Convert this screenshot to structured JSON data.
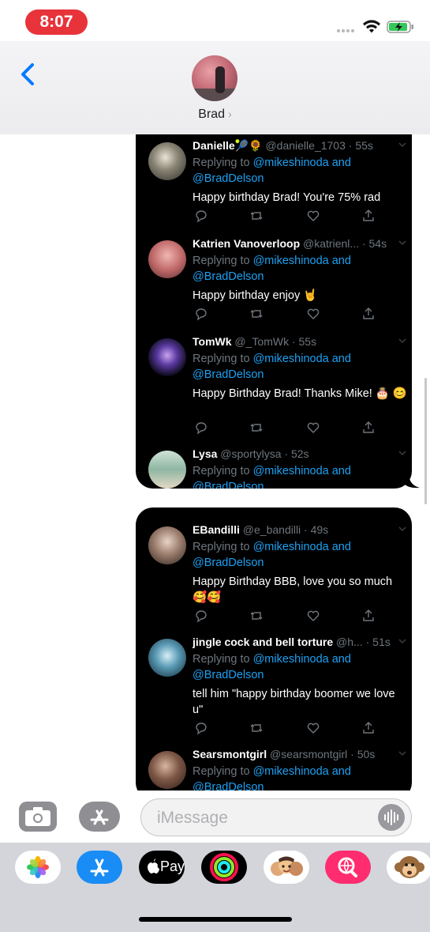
{
  "status_bar": {
    "time": "8:07"
  },
  "header": {
    "contact_name": "Brad"
  },
  "bubble1": {
    "tweets": [
      {
        "name": "Danielle",
        "handle_meta": "@danielle_1703 · 55s",
        "reply_prefix": "Replying to ",
        "mention1": "@mikeshinoda",
        "reply_and": " and",
        "mention2": "@BradDelson",
        "text": "Happy birthday Brad! You're 75% rad"
      },
      {
        "name": "Katrien Vanoverloop",
        "handle_meta": "@katrienl... · 54s",
        "reply_prefix": "Replying to ",
        "mention1": "@mikeshinoda",
        "reply_and": " and",
        "mention2": "@BradDelson",
        "text": "Happy birthday enjoy 🤘"
      },
      {
        "name": "TomWk",
        "handle_meta": "@_TomWk · 55s",
        "reply_prefix": "Replying to ",
        "mention1": "@mikeshinoda",
        "reply_and": " and",
        "mention2": "@BradDelson",
        "text": "Happy Birthday Brad! Thanks Mike! 🎂 😊"
      },
      {
        "name": "Lysa",
        "handle_meta": "@sportylysa · 52s",
        "reply_prefix": "Replying to ",
        "mention1": "@mikeshinoda",
        "reply_and": " and",
        "mention2": "@BradDelson",
        "text": ""
      }
    ]
  },
  "bubble2": {
    "tweets": [
      {
        "name": "EBandilli",
        "handle_meta": "@e_bandilli · 49s",
        "reply_prefix": "Replying to ",
        "mention1": "@mikeshinoda",
        "reply_and": " and",
        "mention2": "@BradDelson",
        "text": "Happy Birthday BBB, love you so much 🥰🥰"
      },
      {
        "name": "jingle cock and bell torture",
        "handle_meta": "@h... · 51s",
        "reply_prefix": "Replying to ",
        "mention1": "@mikeshinoda",
        "reply_and": " and",
        "mention2": "@BradDelson",
        "text": "tell him \"happy birthday boomer we love u\""
      },
      {
        "name": "Searsmontgirl",
        "handle_meta": "@searsmontgirl · 50s",
        "reply_prefix": "Replying to ",
        "mention1": "@mikeshinoda",
        "reply_and": " and",
        "mention2": "@BradDelson",
        "text": ""
      }
    ]
  },
  "input": {
    "placeholder": "iMessage"
  },
  "drawer": {
    "apps": [
      {
        "icon": "photos-app-icon"
      },
      {
        "icon": "app-store-icon"
      },
      {
        "icon": "apple-pay-icon",
        "label": "Pay"
      },
      {
        "icon": "activity-rings-icon"
      },
      {
        "icon": "memoji-icon"
      },
      {
        "icon": "image-search-icon"
      },
      {
        "icon": "animoji-monkey-icon"
      }
    ]
  },
  "colors": {
    "accent": "#007aff",
    "time_pill": "#e8333b",
    "mention": "#1da1f2",
    "bubble": "#000000"
  }
}
